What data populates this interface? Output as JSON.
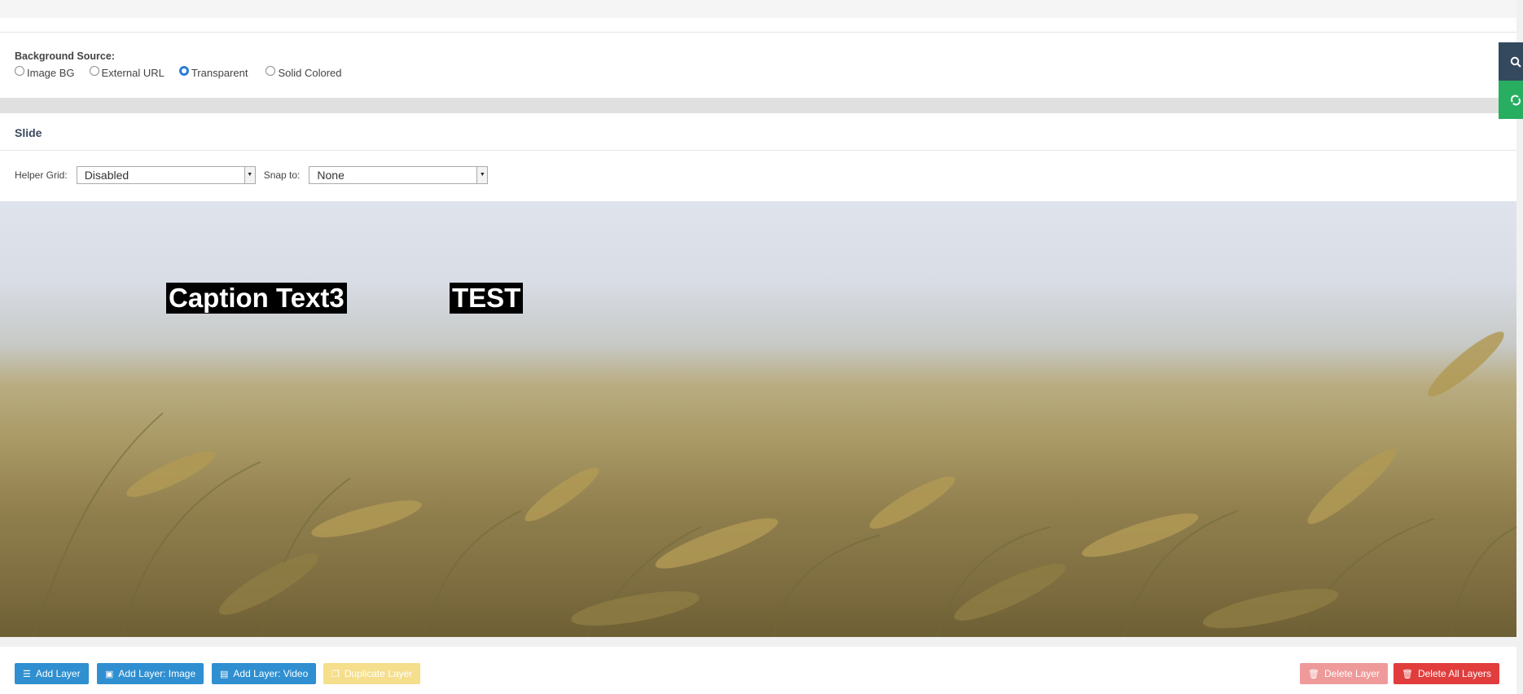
{
  "background": {
    "label": "Background Source:",
    "options": [
      "Image BG",
      "External URL",
      "Transparent",
      "Solid Colored"
    ],
    "selected": "Transparent"
  },
  "slide": {
    "title": "Slide",
    "helper_grid_label": "Helper Grid:",
    "helper_grid_value": "Disabled",
    "snap_to_label": "Snap to:",
    "snap_to_value": "None"
  },
  "layers": {
    "caption1": "Caption Text3",
    "caption2": "TEST"
  },
  "toolbar": {
    "add_layer": "Add Layer",
    "add_layer_image": "Add Layer: Image",
    "add_layer_video": "Add Layer: Video",
    "duplicate_layer": "Duplicate Layer",
    "delete_layer": "Delete Layer",
    "delete_all_layers": "Delete All Layers"
  },
  "icons": {
    "search": "search-icon",
    "refresh": "refresh-icon",
    "add_layer": "layers-icon",
    "image": "image-icon",
    "video": "film-icon",
    "duplicate": "copy-icon",
    "trash": "trash-icon"
  },
  "colors": {
    "primary": "#2f8fd0",
    "warning": "#f5de8c",
    "danger": "#e13d3d",
    "danger_disabled": "#ef9a9a",
    "sidebar_dark": "#34495e",
    "sidebar_green": "#27ae60",
    "radio_selected": "#2e7dd7"
  }
}
